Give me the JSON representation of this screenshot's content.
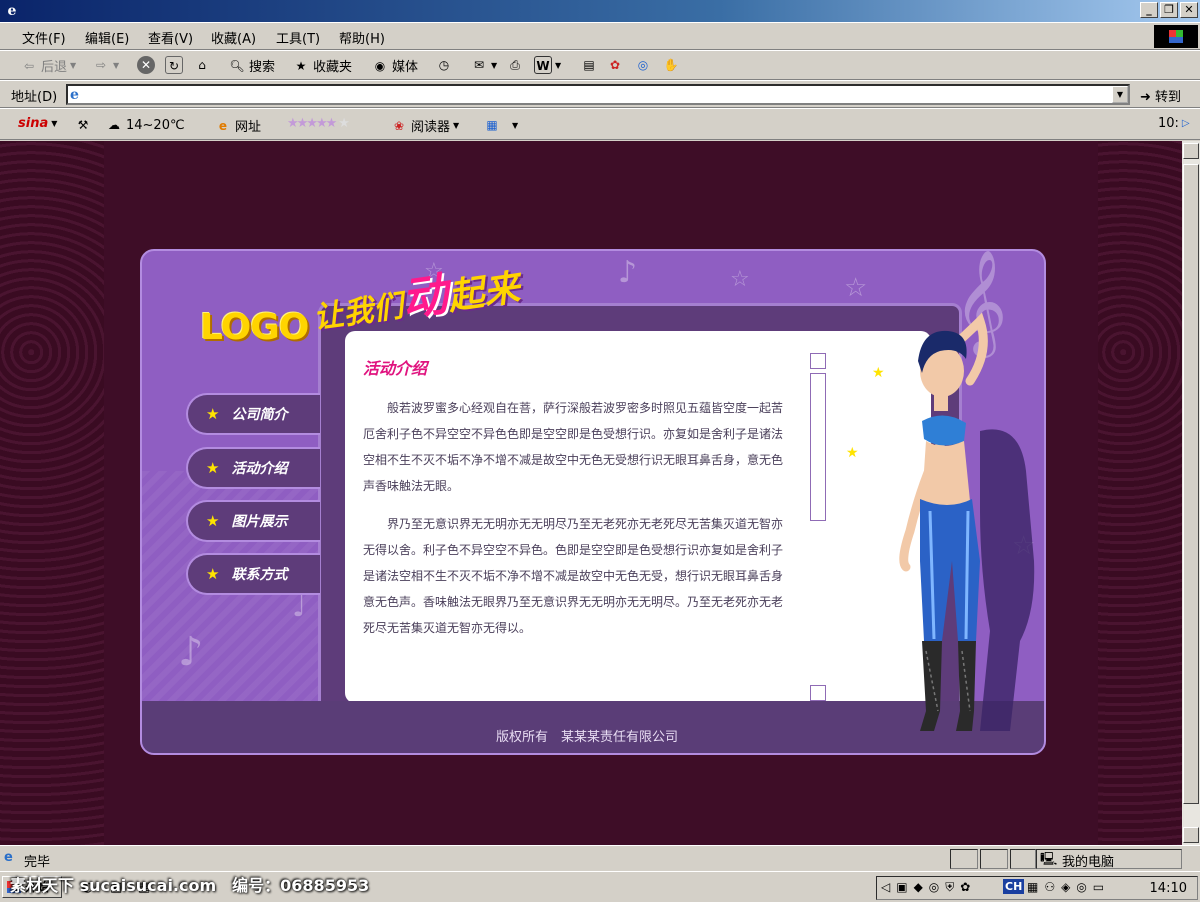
{
  "menubar": {
    "items": [
      "文件(F)",
      "编辑(E)",
      "查看(V)",
      "收藏(A)",
      "工具(T)",
      "帮助(H)"
    ]
  },
  "toolbar": {
    "back_label": "后退",
    "search_label": "搜索",
    "favorites_label": "收藏夹",
    "media_label": "媒体"
  },
  "addressbar": {
    "label": "地址(D)",
    "value": "",
    "go_label": "转到"
  },
  "linksbar": {
    "sina_label": "sina",
    "weather": "14~20℃",
    "url_label": "网址",
    "reader_label": "阅读器",
    "right_text": "10:"
  },
  "site": {
    "logo": "LOGO",
    "slogan": [
      "让我们",
      "动",
      "起来"
    ],
    "nav": [
      "公司简介",
      "活动介绍",
      "图片展示",
      "联系方式"
    ],
    "content": {
      "title": "活动介绍",
      "paragraphs": [
        "般若波罗蜜多心经观自在菩，萨行深般若波罗密多时照见五蕴皆空度一起苦厄舍利子色不异空空不异色色即是空空即是色受想行识。亦复如是舍利子是诸法空相不生不灭不垢不净不增不减是故空中无色无受想行识无眼耳鼻舌身，意无色声香味触法无眼。",
        "界乃至无意识界无无明亦无无明尽乃至无老死亦无老死尽无苦集灭道无智亦无得以舍。利子色不异空空不异色。色即是空空即是色受想行识亦复如是舍利子是诸法空相不生不灭不垢不净不增不减是故空中无色无受，想行识无眼耳鼻舌身意无色声。香味触法无眼界乃至无意识界无无明亦无无明尽。乃至无老死亦无老死尽无苦集灭道无智亦无得以。"
      ]
    },
    "footer": "版权所有　某某某责任有限公司"
  },
  "statusbar": {
    "status": "完毕",
    "zone": "我的电脑"
  },
  "taskbar": {
    "start_label": "开始",
    "watermark": "素材天下 sucaisucai.com　编号：06885953",
    "input_indicator": "CH",
    "clock": "14:10"
  }
}
